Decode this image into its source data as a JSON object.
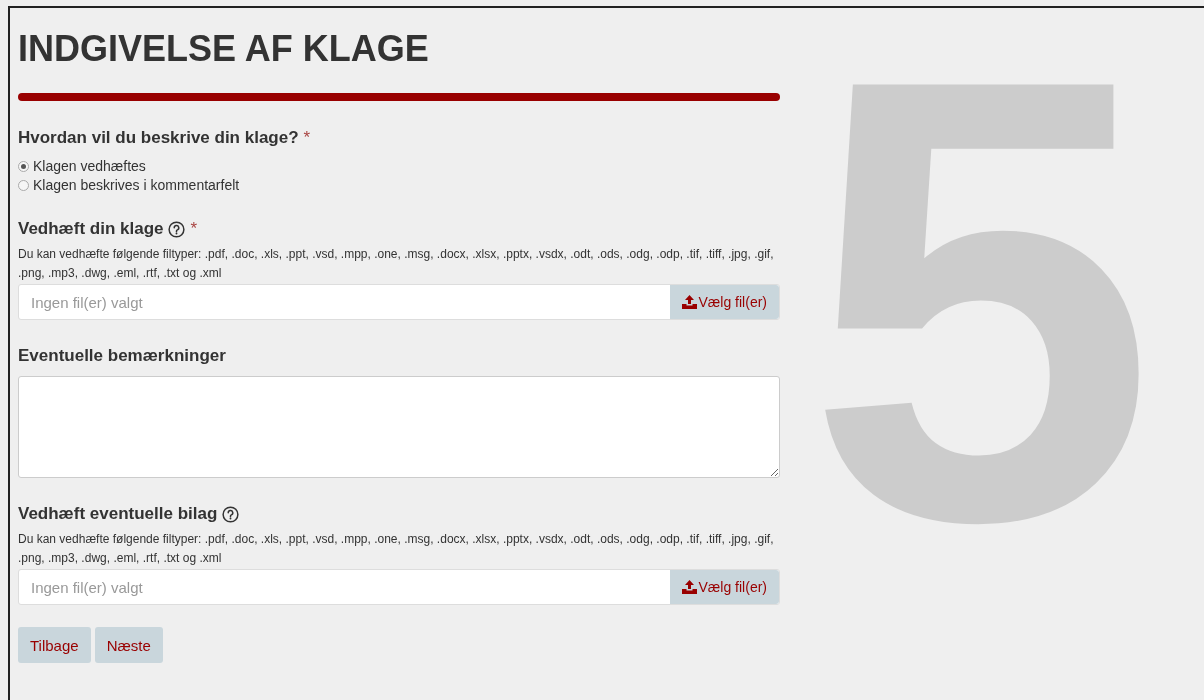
{
  "title": "INDGIVELSE AF KLAGE",
  "step_number": "5",
  "sections": [
    {
      "kind": "radio",
      "label": "Hvordan vil du beskrive din klage?",
      "required_mark": "*",
      "help": false,
      "options": [
        {
          "label": "Klagen vedhæftes",
          "selected": true
        },
        {
          "label": "Klagen beskrives i kommentarfelt",
          "selected": false
        }
      ]
    },
    {
      "kind": "file",
      "label": "Vedhæft din klage",
      "required_mark": "*",
      "help": true,
      "hint": "Du kan vedhæfte følgende filtyper: .pdf, .doc, .xls, .ppt, .vsd, .mpp, .one, .msg, .docx, .xlsx, .pptx, .vsdx, .odt, .ods, .odg, .odp, .tif, .tiff, .jpg, .gif, .png, .mp3, .dwg, .eml, .rtf, .txt og .xml",
      "placeholder": "Ingen fil(er) valgt",
      "button": "Vælg fil(er)"
    },
    {
      "kind": "textarea",
      "label": "Eventuelle bemærkninger",
      "help": false
    },
    {
      "kind": "file",
      "label": "Vedhæft eventuelle bilag",
      "help": true,
      "hint": "Du kan vedhæfte følgende filtyper: .pdf, .doc, .xls, .ppt, .vsd, .mpp, .one, .msg, .docx, .xlsx, .pptx, .vsdx, .odt, .ods, .odg, .odp, .tif, .tiff, .jpg, .gif, .png, .mp3, .dwg, .eml, .rtf, .txt og .xml",
      "placeholder": "Ingen fil(er) valgt",
      "button": "Vælg fil(er)"
    }
  ],
  "buttons": [
    "Tilbage",
    "Næste"
  ]
}
